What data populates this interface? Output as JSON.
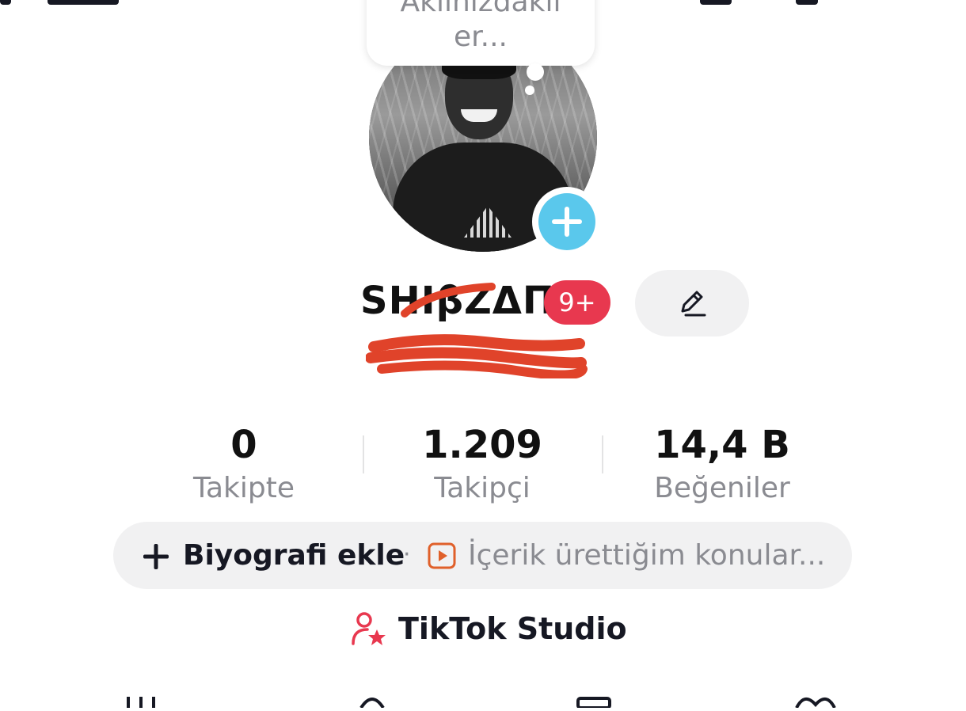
{
  "speech_bubble": {
    "line1": "Aklınızdakil",
    "line2": "er..."
  },
  "profile": {
    "display_name": "SHIβZΔΠ",
    "notification_badge": "9+"
  },
  "stats": [
    {
      "value": "0",
      "label": "Takipte"
    },
    {
      "value": "1.209",
      "label": "Takipçi"
    },
    {
      "value": "14,4 B",
      "label": "Beğeniler"
    }
  ],
  "bio": {
    "add_label": "Biyografi ekle",
    "separator": "·",
    "hint": "İçerik ürettiğim konular..."
  },
  "studio": {
    "label": "TikTok Studio"
  },
  "icons": {
    "avatar_add": "plus-icon",
    "edit": "pencil-icon",
    "bio_add": "plus-icon",
    "bio_video": "video-play-icon",
    "studio": "user-star-icon"
  },
  "colors": {
    "accent_red": "#e8384f",
    "badge_blue": "#5ac8ec",
    "pill_bg": "#f1f1f2",
    "muted_text": "#8a8b91",
    "scribble": "#e0432a"
  }
}
